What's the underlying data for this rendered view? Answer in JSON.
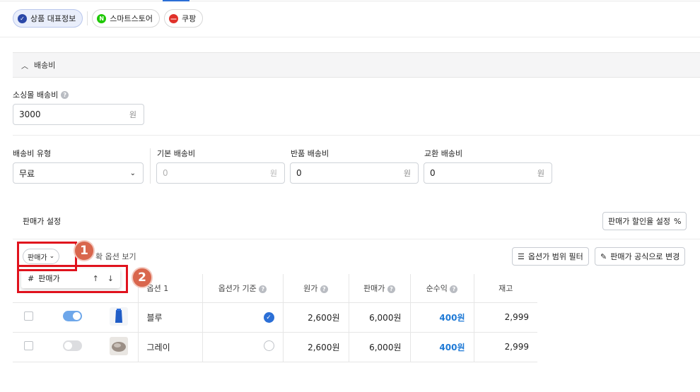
{
  "channels": [
    {
      "label": "상품 대표정보",
      "icon": "check-circle-icon",
      "color": "#2b48a8"
    },
    {
      "label": "스마트스토어",
      "icon": "naver-n-icon",
      "color": "#1ec800"
    },
    {
      "label": "쿠팡",
      "icon": "coupang-icon",
      "color": "#e0312a"
    }
  ],
  "shipping": {
    "section_title": "배송비",
    "mall_fee_label": "소싱몰 배송비",
    "mall_fee_value": "3000",
    "unit": "원",
    "type_label": "배송비 유형",
    "type_value": "무료",
    "base_label": "기본 배송비",
    "base_placeholder": "0",
    "return_label": "반품 배송비",
    "return_value": "0",
    "exchange_label": "교환 배송비",
    "exchange_value": "0"
  },
  "pricing": {
    "title": "판매가 설정",
    "discount_button": "판매가 할인율 설정",
    "sort_dropdown": "판매가",
    "option_view_text": "확 옵션 보기",
    "range_filter_button": "옵션가 범위 필터",
    "formula_button": "판매가 공식으로 변경",
    "popup_label": "판매가",
    "popup_hash": "#",
    "popup_up": "↑",
    "popup_down": "↓"
  },
  "annotations": {
    "badge1": "1",
    "badge2": "2"
  },
  "table": {
    "headers": {
      "option1": "옵션 1",
      "option_base": "옵션가 기준",
      "cost": "원가",
      "price": "판매가",
      "profit": "순수익",
      "stock": "재고"
    },
    "rows": [
      {
        "option": "블루",
        "cost": "2,600원",
        "price": "6,000원",
        "profit": "400원",
        "stock": "2,999",
        "toggle": "on",
        "base": "on",
        "thumb_color": "#1f5cc6"
      },
      {
        "option": "그레이",
        "cost": "2,600원",
        "price": "6,000원",
        "profit": "400원",
        "stock": "2,999",
        "toggle": "off",
        "base": "off",
        "thumb_color": "#9b8f86"
      }
    ]
  }
}
